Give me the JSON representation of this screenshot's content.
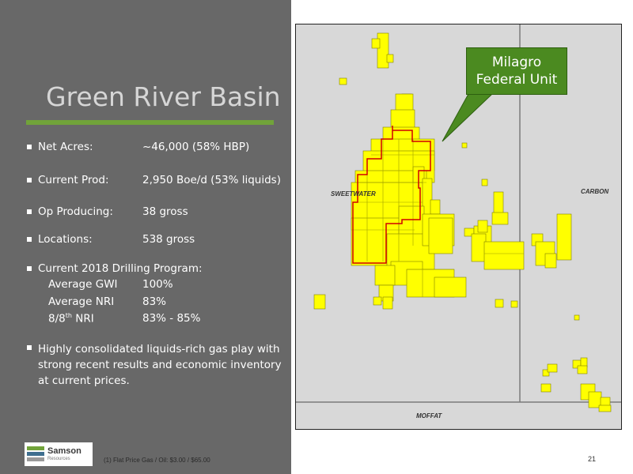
{
  "slide": {
    "title": "Green River Basin",
    "bullets": [
      {
        "label": "Net Acres:",
        "value": "~46,000 (58% HBP)"
      },
      {
        "label": "Current Prod:",
        "value": "2,950 Boe/d (53%  liquids)"
      },
      {
        "label": "Op Producing:",
        "value": "38 gross"
      },
      {
        "label": "Locations:",
        "value": "538 gross"
      }
    ],
    "drilling": {
      "heading": "Current 2018 Drilling Program:",
      "rows": [
        {
          "label": "Average GWI",
          "value": "100%"
        },
        {
          "label": "Average NRI",
          "value": "83%"
        },
        {
          "label_main": "8/8",
          "label_sup": "th",
          "label_tail": " NRI",
          "value": "83% - 85%"
        }
      ]
    },
    "summary": "Highly consolidated liquids-rich gas play with strong recent results and economic inventory at current prices.",
    "footnote": "(1)  Flat Price Gas / Oil: $3.00 / $65.00",
    "page_number": "21",
    "logo": {
      "name": "Samson",
      "sub": "Resources"
    }
  },
  "map": {
    "counties": [
      "SWEETWATER",
      "CARBON",
      "MOFFAT"
    ],
    "callout": {
      "line1": "Milagro",
      "line2": "Federal Unit"
    },
    "colors": {
      "acreage": "#ffff00",
      "unit_outline": "#d00000",
      "callout": "#4b8a20",
      "accent_bar": "#71a33a"
    }
  }
}
